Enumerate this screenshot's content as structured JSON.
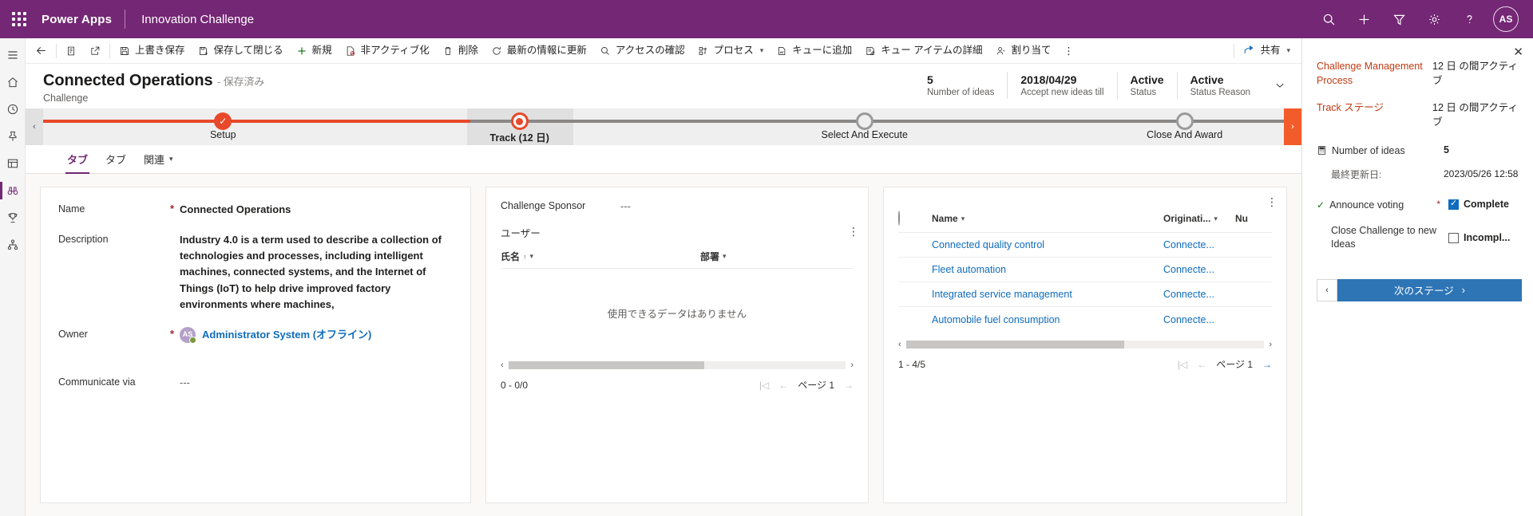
{
  "topbar": {
    "brand": "Power Apps",
    "app_name": "Innovation Challenge",
    "avatar_initials": "AS",
    "icons": [
      "search-icon",
      "plus-icon",
      "filter-icon",
      "gear-icon",
      "help-icon"
    ]
  },
  "commandbar": {
    "back": "back-arrow-icon",
    "items": [
      {
        "label": "上書き保存",
        "icon": "save-icon"
      },
      {
        "label": "保存して閉じる",
        "icon": "save-close-icon"
      },
      {
        "label": "新規",
        "icon": "plus-icon"
      },
      {
        "label": "非アクティブ化",
        "icon": "deactivate-icon"
      },
      {
        "label": "削除",
        "icon": "trash-icon"
      },
      {
        "label": "最新の情報に更新",
        "icon": "refresh-icon"
      },
      {
        "label": "アクセスの確認",
        "icon": "check-access-icon"
      },
      {
        "label": "プロセス",
        "icon": "process-icon",
        "caret": true
      },
      {
        "label": "キューに追加",
        "icon": "add-queue-icon"
      },
      {
        "label": "キュー アイテムの詳細",
        "icon": "queue-item-icon"
      },
      {
        "label": "割り当て",
        "icon": "assign-icon"
      }
    ],
    "overflow": "⋮",
    "share_label": "共有"
  },
  "record": {
    "title": "Connected Operations",
    "saved_state": "- 保存済み",
    "subtitle": "Challenge",
    "stats": [
      {
        "value": "5",
        "key": "Number of ideas"
      },
      {
        "value": "2018/04/29",
        "key": "Accept new ideas till"
      },
      {
        "value": "Active",
        "key": "Status"
      },
      {
        "value": "Active",
        "key": "Status Reason"
      }
    ]
  },
  "bpf": {
    "stages": [
      {
        "label": "Setup",
        "state": "done"
      },
      {
        "label": "Track (12 日)",
        "state": "current"
      },
      {
        "label": "Select And Execute",
        "state": "future"
      },
      {
        "label": "Close And Award",
        "state": "future"
      }
    ]
  },
  "tabs": [
    {
      "label": "タブ",
      "selected": true
    },
    {
      "label": "タブ",
      "selected": false
    },
    {
      "label": "関連",
      "selected": false,
      "caret": true
    }
  ],
  "form": {
    "name_label": "Name",
    "name_value": "Connected Operations",
    "description_label": "Description",
    "description_value": "Industry 4.0 is a term used to describe a collection of technologies and processes, including intelligent machines, connected systems, and the Internet of Things (IoT) to help drive improved factory environments where machines,",
    "owner_label": "Owner",
    "owner_initials": "AS",
    "owner_value": "Administrator System (オフライン)",
    "communicate_label": "Communicate via",
    "communicate_value": "---"
  },
  "sponsor_card": {
    "sponsor_label": "Challenge Sponsor",
    "sponsor_value": "---",
    "section_title": "ユーザー",
    "columns": [
      {
        "label": "氏名",
        "sort": "↑"
      },
      {
        "label": "部署",
        "sort": ""
      }
    ],
    "empty_message": "使用できるデータはありません",
    "count": "0 - 0/0",
    "page_label": "ページ 1",
    "kebab": "⋮"
  },
  "ideas_grid": {
    "kebab": "⋮",
    "columns": [
      {
        "label": "Name"
      },
      {
        "label": "Originati..."
      },
      {
        "label": "Nu"
      }
    ],
    "rows": [
      {
        "name": "Connected quality control",
        "originating": "Connecte..."
      },
      {
        "name": "Fleet automation",
        "originating": "Connecte..."
      },
      {
        "name": "Integrated service management",
        "originating": "Connecte..."
      },
      {
        "name": "Automobile fuel consumption",
        "originating": "Connecte..."
      }
    ],
    "count": "1 - 4/5",
    "page_label": "ページ 1"
  },
  "rightpane": {
    "close": "✕",
    "process_name": "Challenge Management Process",
    "process_duration": "12 日 の間アクティブ",
    "stage_name": "Track ステージ",
    "stage_duration": "12 日 の間アクティブ",
    "field_label": "Number of ideas",
    "field_value": "5",
    "modified_label": "最終更新日:",
    "modified_value": "2023/05/26 12:58",
    "step1_label": "Announce voting",
    "step1_required": "*",
    "step1_check_label": "Complete",
    "step1_checked": true,
    "step2_label": "Close Challenge to new Ideas",
    "step2_check_label": "Incompl...",
    "step2_checked": false,
    "next_stage_label": "次のステージ"
  },
  "colors": {
    "brand_purple": "#742774",
    "bpf_accent": "#e8492a",
    "link_blue": "#0f6cbd",
    "next_button": "#2e75b6"
  }
}
